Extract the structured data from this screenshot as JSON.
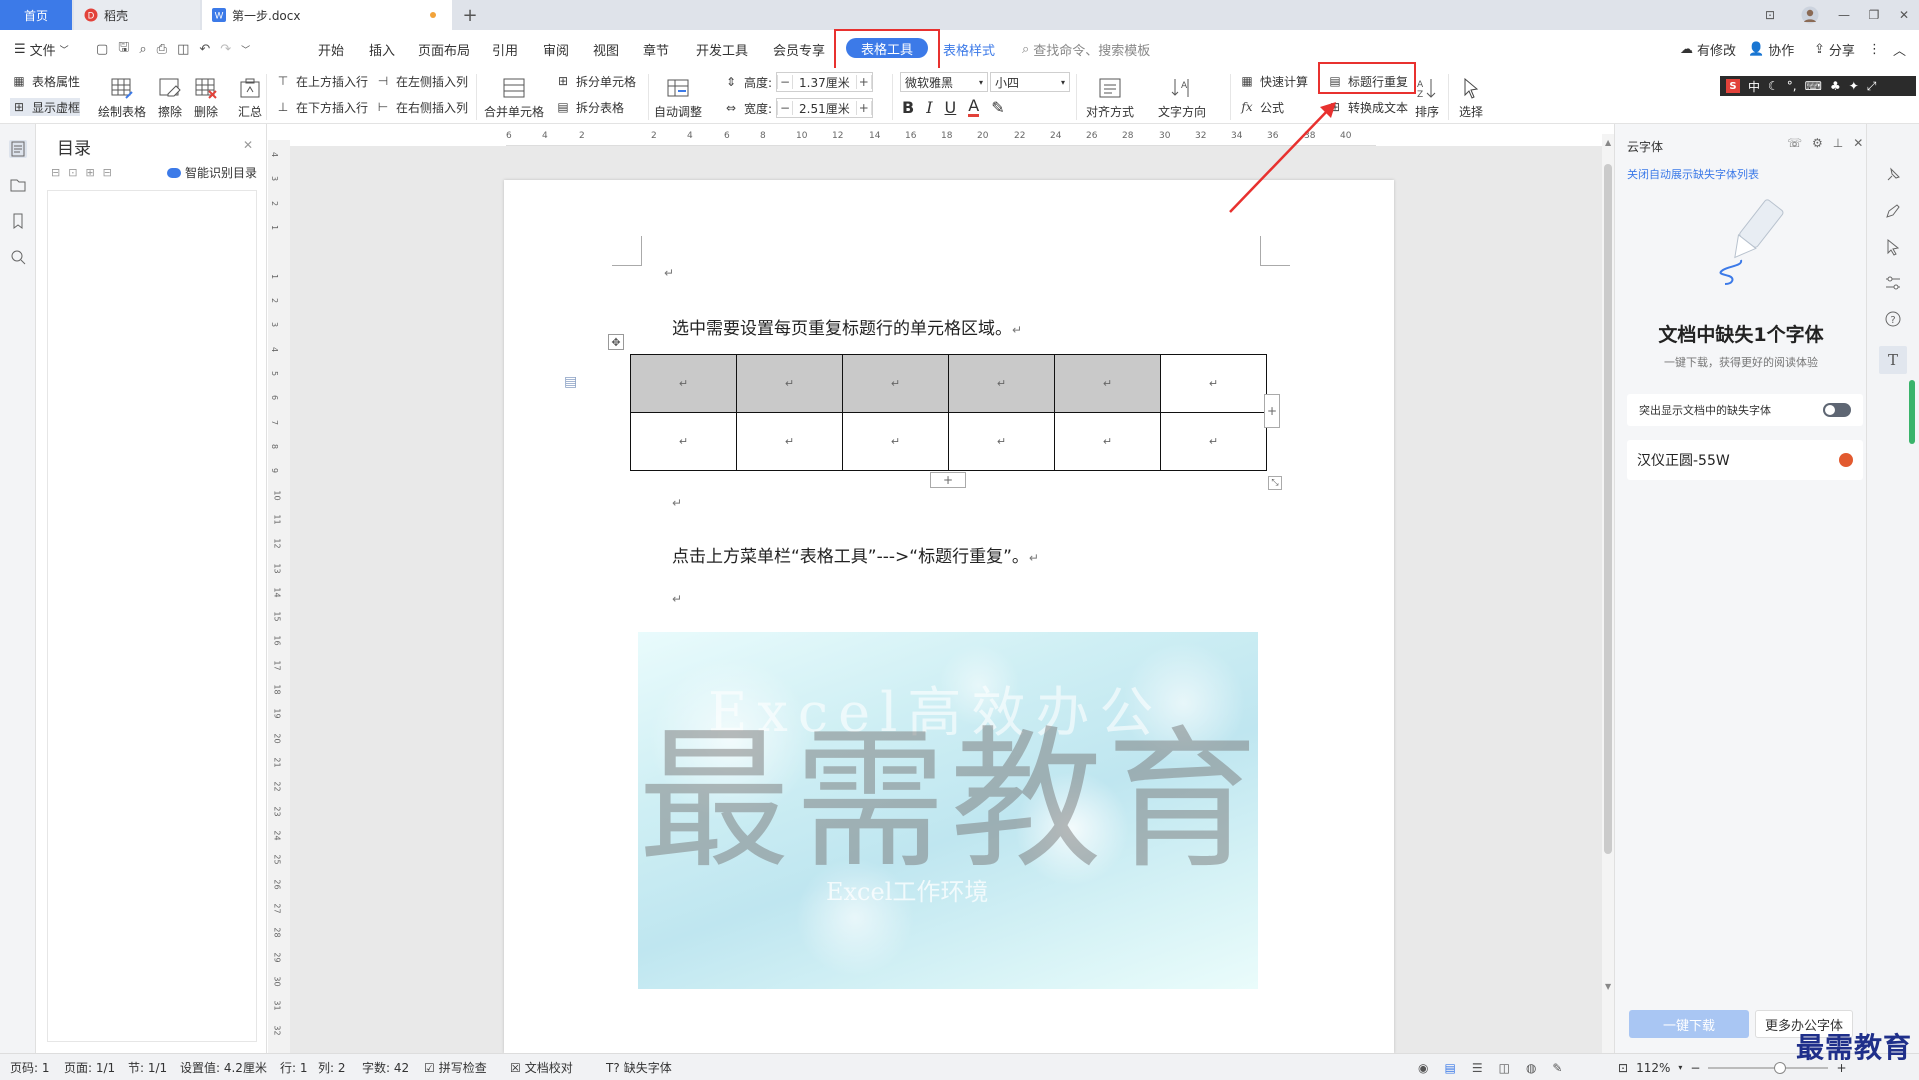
{
  "tabs": {
    "home": "首页",
    "daoke": "稻壳",
    "doc": "第一步.docx",
    "add": "+"
  },
  "window": {
    "minimize": "—",
    "maximize": "❐",
    "close": "✕",
    "layout_icon": "⊡"
  },
  "menu": {
    "file": "文件",
    "items": [
      "开始",
      "插入",
      "页面布局",
      "引用",
      "审阅",
      "视图",
      "章节",
      "开发工具",
      "会员专享"
    ],
    "active": "表格工具",
    "table_style": "表格样式",
    "search_placeholder": "查找命令、搜索模板",
    "has_edit": "有修改",
    "collab": "协作",
    "share": "分享",
    "more": "⋮",
    "collapse": "︿"
  },
  "ribbon": {
    "table_props": "表格属性",
    "show_grid": "显示虚框",
    "draw_table": "绘制表格",
    "erase": "擦除",
    "delete": "删除",
    "summary": "汇总",
    "insert_above": "在上方插入行",
    "insert_below": "在下方插入行",
    "insert_left": "在左侧插入列",
    "insert_right": "在右侧插入列",
    "merge": "合并单元格",
    "split_cell": "拆分单元格",
    "split_table": "拆分表格",
    "auto_fit": "自动调整",
    "height_label": "高度:",
    "height_value": "1.37厘米",
    "width_label": "宽度:",
    "width_value": "2.51厘米",
    "font_name": "微软雅黑",
    "font_size": "小四",
    "bold": "B",
    "italic": "I",
    "underline": "U",
    "font_color": "A",
    "align": "对齐方式",
    "text_dir": "文字方向",
    "quick_calc": "快速计算",
    "formula": "公式",
    "header_repeat": "标题行重复",
    "convert_text": "转换成文本",
    "sort": "排序",
    "select": "选择"
  },
  "ime": {
    "logo": "S",
    "lang": "中"
  },
  "toc": {
    "title": "目录",
    "smart": "智能识别目录",
    "close": "✕"
  },
  "ruler": {
    "h_ticks": [
      "6",
      "4",
      "2",
      "",
      "2",
      "4",
      "6",
      "8",
      "10",
      "12",
      "14",
      "16",
      "18",
      "20",
      "22",
      "24",
      "26",
      "28",
      "30",
      "32",
      "34",
      "36",
      "38",
      "40"
    ],
    "v_ticks": [
      "4",
      "3",
      "2",
      "1",
      "",
      "1",
      "2",
      "3",
      "4",
      "5",
      "6",
      "7",
      "8",
      "9",
      "10",
      "11",
      "12",
      "13",
      "14",
      "15",
      "16",
      "17",
      "18",
      "19",
      "20",
      "21",
      "22",
      "23",
      "24",
      "25",
      "26",
      "27",
      "28",
      "29",
      "30",
      "31",
      "32"
    ]
  },
  "document": {
    "para_mark": "↵",
    "line1": "选中需要设置每页重复标题行的单元格区域。",
    "line2": "点击上方菜单栏“表格工具”--->“标题行重复”。",
    "table": {
      "rows": 2,
      "cols": 6,
      "shaded_header_cols": 5
    },
    "table_add": "+",
    "banner": {
      "watermark": "最需教育",
      "top_text": "Excel高效办公",
      "bottom_text": "Excel工作环境"
    }
  },
  "right_panel": {
    "title": "云字体",
    "close_link": "关闭自动展示缺失字体列表",
    "heading": "文档中缺失1个字体",
    "subheading": "一键下载，获得更好的阅读体验",
    "toggle_label": "突出显示文档中的缺失字体",
    "toggle_on": false,
    "font_item": "汉仪正圆-55W",
    "download_btn": "一键下载",
    "more_fonts": "更多办公字体"
  },
  "status": {
    "page_no": "页码: 1",
    "page": "页面: 1/1",
    "section": "节: 1/1",
    "setting": "设置值: 4.2厘米",
    "row": "行: 1",
    "col": "列: 2",
    "words": "字数: 42",
    "spell": "拼写检查",
    "proof": "文档校对",
    "missing_font": "缺失字体",
    "zoom": "112%",
    "zoom_minus": "−",
    "zoom_plus": "+"
  },
  "corner_watermark": "最需教育",
  "colors": {
    "accent": "#3c7ae8",
    "highlight": "#e8312f",
    "header_shade": "#c9c9c9"
  }
}
